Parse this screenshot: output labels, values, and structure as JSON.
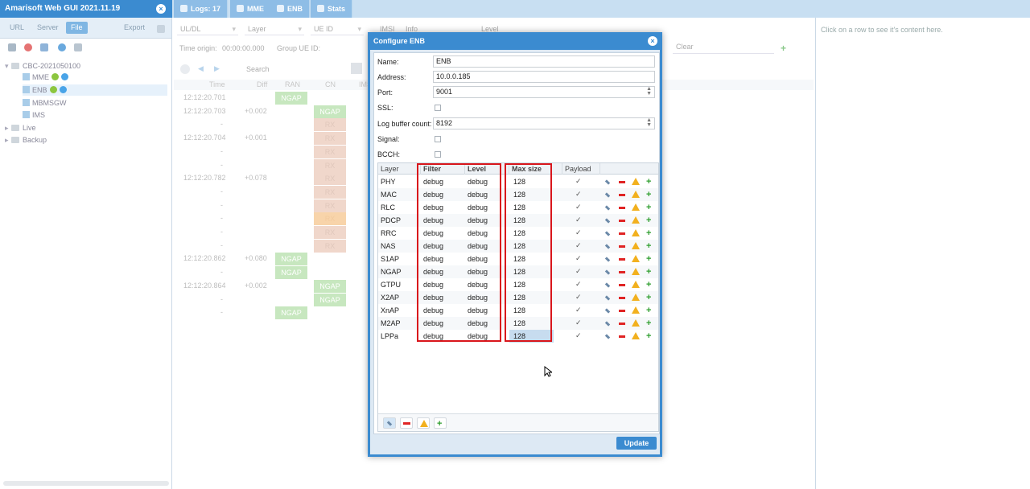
{
  "app": {
    "title": "Amarisoft Web GUI 2021.11.19",
    "tabs": [
      {
        "label": "Logs: 17"
      },
      {
        "label": "MME"
      },
      {
        "label": "ENB"
      },
      {
        "label": "Stats"
      }
    ]
  },
  "left": {
    "tabs": [
      "URL",
      "Server",
      "File"
    ],
    "active_tab": "File",
    "export_label": "Export",
    "tree": [
      {
        "label": "CBC-2021050100"
      },
      {
        "label": "MME"
      },
      {
        "label": "ENB"
      },
      {
        "label": "MBMSGW"
      },
      {
        "label": "IMS"
      },
      {
        "label": "Live"
      },
      {
        "label": "Backup"
      }
    ]
  },
  "center": {
    "filters": {
      "uldl": "UL/DL",
      "layer": "Layer",
      "ueid": "UE ID",
      "imsi": "IMSI",
      "info": "Info",
      "level": "Level",
      "clear": "Clear"
    },
    "time_origin_label": "Time origin:",
    "time_origin_value": "00:00:00.000",
    "group_ue_label": "Group UE ID:",
    "search_label": "Search",
    "columns": [
      "Time",
      "Diff",
      "RAN",
      "CN",
      "IMS"
    ],
    "rows": [
      {
        "time": "12:12:20.701",
        "diff": ""
      },
      {
        "time": "12:12:20.703",
        "diff": "+0.002"
      },
      {
        "time": "-",
        "diff": ""
      },
      {
        "time": "12:12:20.704",
        "diff": "+0.001"
      },
      {
        "time": "-",
        "diff": ""
      },
      {
        "time": "-",
        "diff": ""
      },
      {
        "time": "12:12:20.782",
        "diff": "+0.078"
      },
      {
        "time": "-",
        "diff": ""
      },
      {
        "time": "-",
        "diff": ""
      },
      {
        "time": "-",
        "diff": ""
      },
      {
        "time": "-",
        "diff": ""
      },
      {
        "time": "-",
        "diff": ""
      },
      {
        "time": "12:12:20.862",
        "diff": "+0.080"
      },
      {
        "time": "-",
        "diff": ""
      },
      {
        "time": "12:12:20.864",
        "diff": "+0.002"
      },
      {
        "time": "-",
        "diff": ""
      },
      {
        "time": "-",
        "diff": ""
      }
    ],
    "box_ngap": "NGAP",
    "box_rx": "RX"
  },
  "right": {
    "hint": "Click on a row to see it's content here."
  },
  "dialog": {
    "title": "Configure ENB",
    "fields": {
      "name_label": "Name:",
      "name_value": "ENB",
      "address_label": "Address:",
      "address_value": "10.0.0.185",
      "port_label": "Port:",
      "port_value": "9001",
      "ssl_label": "SSL:",
      "logbuf_label": "Log buffer count:",
      "logbuf_value": "8192",
      "signal_label": "Signal:",
      "bcch_label": "BCCH:"
    },
    "grid": {
      "headers": {
        "layer": "Layer",
        "filter": "Filter",
        "level": "Level",
        "maxsize": "Max size",
        "payload": "Payload"
      },
      "rows": [
        {
          "layer": "PHY",
          "filter": "debug",
          "level": "debug",
          "maxsize": "128",
          "payload": true
        },
        {
          "layer": "MAC",
          "filter": "debug",
          "level": "debug",
          "maxsize": "128",
          "payload": true
        },
        {
          "layer": "RLC",
          "filter": "debug",
          "level": "debug",
          "maxsize": "128",
          "payload": true
        },
        {
          "layer": "PDCP",
          "filter": "debug",
          "level": "debug",
          "maxsize": "128",
          "payload": true
        },
        {
          "layer": "RRC",
          "filter": "debug",
          "level": "debug",
          "maxsize": "128",
          "payload": true
        },
        {
          "layer": "NAS",
          "filter": "debug",
          "level": "debug",
          "maxsize": "128",
          "payload": true
        },
        {
          "layer": "S1AP",
          "filter": "debug",
          "level": "debug",
          "maxsize": "128",
          "payload": true
        },
        {
          "layer": "NGAP",
          "filter": "debug",
          "level": "debug",
          "maxsize": "128",
          "payload": true
        },
        {
          "layer": "GTPU",
          "filter": "debug",
          "level": "debug",
          "maxsize": "128",
          "payload": true
        },
        {
          "layer": "X2AP",
          "filter": "debug",
          "level": "debug",
          "maxsize": "128",
          "payload": true
        },
        {
          "layer": "XnAP",
          "filter": "debug",
          "level": "debug",
          "maxsize": "128",
          "payload": true
        },
        {
          "layer": "M2AP",
          "filter": "debug",
          "level": "debug",
          "maxsize": "128",
          "payload": true
        },
        {
          "layer": "LPPa",
          "filter": "debug",
          "level": "debug",
          "maxsize": "128",
          "payload": true
        }
      ]
    },
    "update_label": "Update"
  },
  "colors": {
    "accent": "#3b8bd0",
    "highlight_border": "#d9161c",
    "ngap_box": "#9ad58c",
    "rx_box": "#e4b8a2"
  }
}
